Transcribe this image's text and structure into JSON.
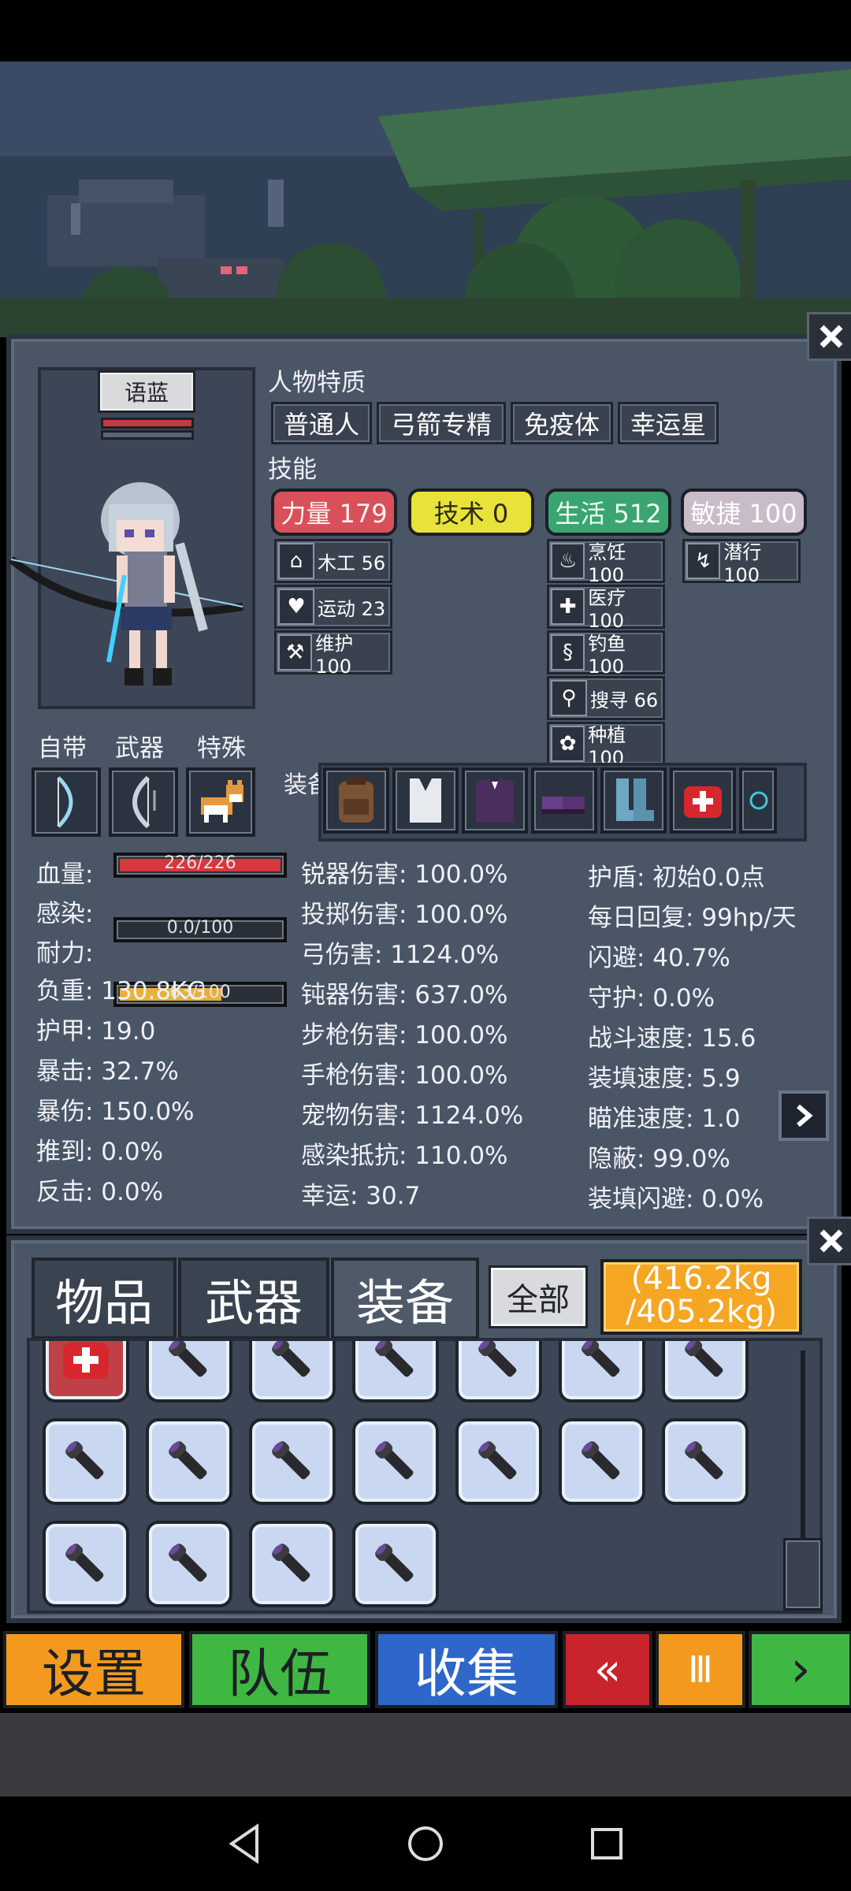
{
  "character": {
    "name": "语蓝",
    "traits_title": "人物特质",
    "traits": [
      "普通人",
      "弓箭专精",
      "免疫体",
      "幸运星"
    ],
    "skills_title": "技能",
    "skill_groups": [
      {
        "label": "力量 179",
        "color": "#d9505a",
        "text_color": "#fff2f2"
      },
      {
        "label": "技术 0",
        "color": "#e9e23a",
        "text_color": "#2a2a10"
      },
      {
        "label": "生活 512",
        "color": "#3aa570",
        "text_color": "#eafff2"
      },
      {
        "label": "敏捷 100",
        "color": "#c9bcc9",
        "text_color": "#ffffff"
      }
    ],
    "sub_skills": {
      "strength": [
        {
          "icon": "house-icon",
          "label": "木工 56"
        },
        {
          "icon": "heart-icon",
          "label": "运动 23"
        },
        {
          "icon": "wrench-icon",
          "label": "维护 100"
        }
      ],
      "life": [
        {
          "icon": "cooking-pot-icon",
          "label": "烹饪 100"
        },
        {
          "icon": "medkit-icon",
          "label": "医疗 100"
        },
        {
          "icon": "fishing-icon",
          "label": "钓鱼 100"
        },
        {
          "icon": "magnifier-icon",
          "label": "搜寻 66"
        },
        {
          "icon": "plant-icon",
          "label": "种植 100"
        }
      ],
      "agility": [
        {
          "icon": "sneak-icon",
          "label": "潜行 100"
        }
      ]
    },
    "slot_labels": [
      "自带",
      "武器",
      "特殊"
    ],
    "equip_label": "装备"
  },
  "stats": {
    "bars": [
      {
        "label": "血量:",
        "value": "226/226",
        "fraction": 1.0,
        "color": "#d8383b"
      },
      {
        "label": "感染:",
        "value": "0.0/100",
        "fraction": 0.0,
        "color": "#888888"
      },
      {
        "label": "耐力:",
        "value": "63/100",
        "fraction": 0.63,
        "color": "#e8b13a"
      }
    ],
    "col1": [
      "负重: 130.8KG",
      "护甲: 19.0",
      "暴击: 32.7%",
      "暴伤: 150.0%",
      "推到: 0.0%",
      "反击: 0.0%"
    ],
    "col2": [
      "锐器伤害: 100.0%",
      "投掷伤害: 100.0%",
      "弓伤害: 1124.0%",
      "钝器伤害: 637.0%",
      "步枪伤害: 100.0%",
      "手枪伤害: 100.0%",
      "宠物伤害: 1124.0%",
      "感染抵抗: 110.0%",
      "幸运: 30.7"
    ],
    "col3": [
      "护盾: 初始0.0点",
      "每日回复: 99hp/天",
      "闪避: 40.7%",
      "守护: 0.0%",
      "战斗速度: 15.6",
      "装填速度: 5.9",
      "瞄准速度: 1.0",
      "隐蔽: 99.0%",
      "装填闪避: 0.0%"
    ]
  },
  "inventory": {
    "tabs": [
      "物品",
      "武器",
      "装备"
    ],
    "filter": "全部",
    "weight": "(416.2kg\n/405.2kg)",
    "weight_line1": "(416.2kg",
    "weight_line2": "/405.2kg)"
  },
  "bottom_bar": {
    "settings": "设置",
    "team": "队伍",
    "collect": "收集",
    "rewind": "«",
    "pause": "Ⅲ",
    "play": "›"
  },
  "colors": {
    "settings": "#f39a1e",
    "team": "#3fb843",
    "collect": "#2e66c9",
    "rewind": "#c8242b",
    "pause": "#f39a1e",
    "play": "#3fb843"
  }
}
